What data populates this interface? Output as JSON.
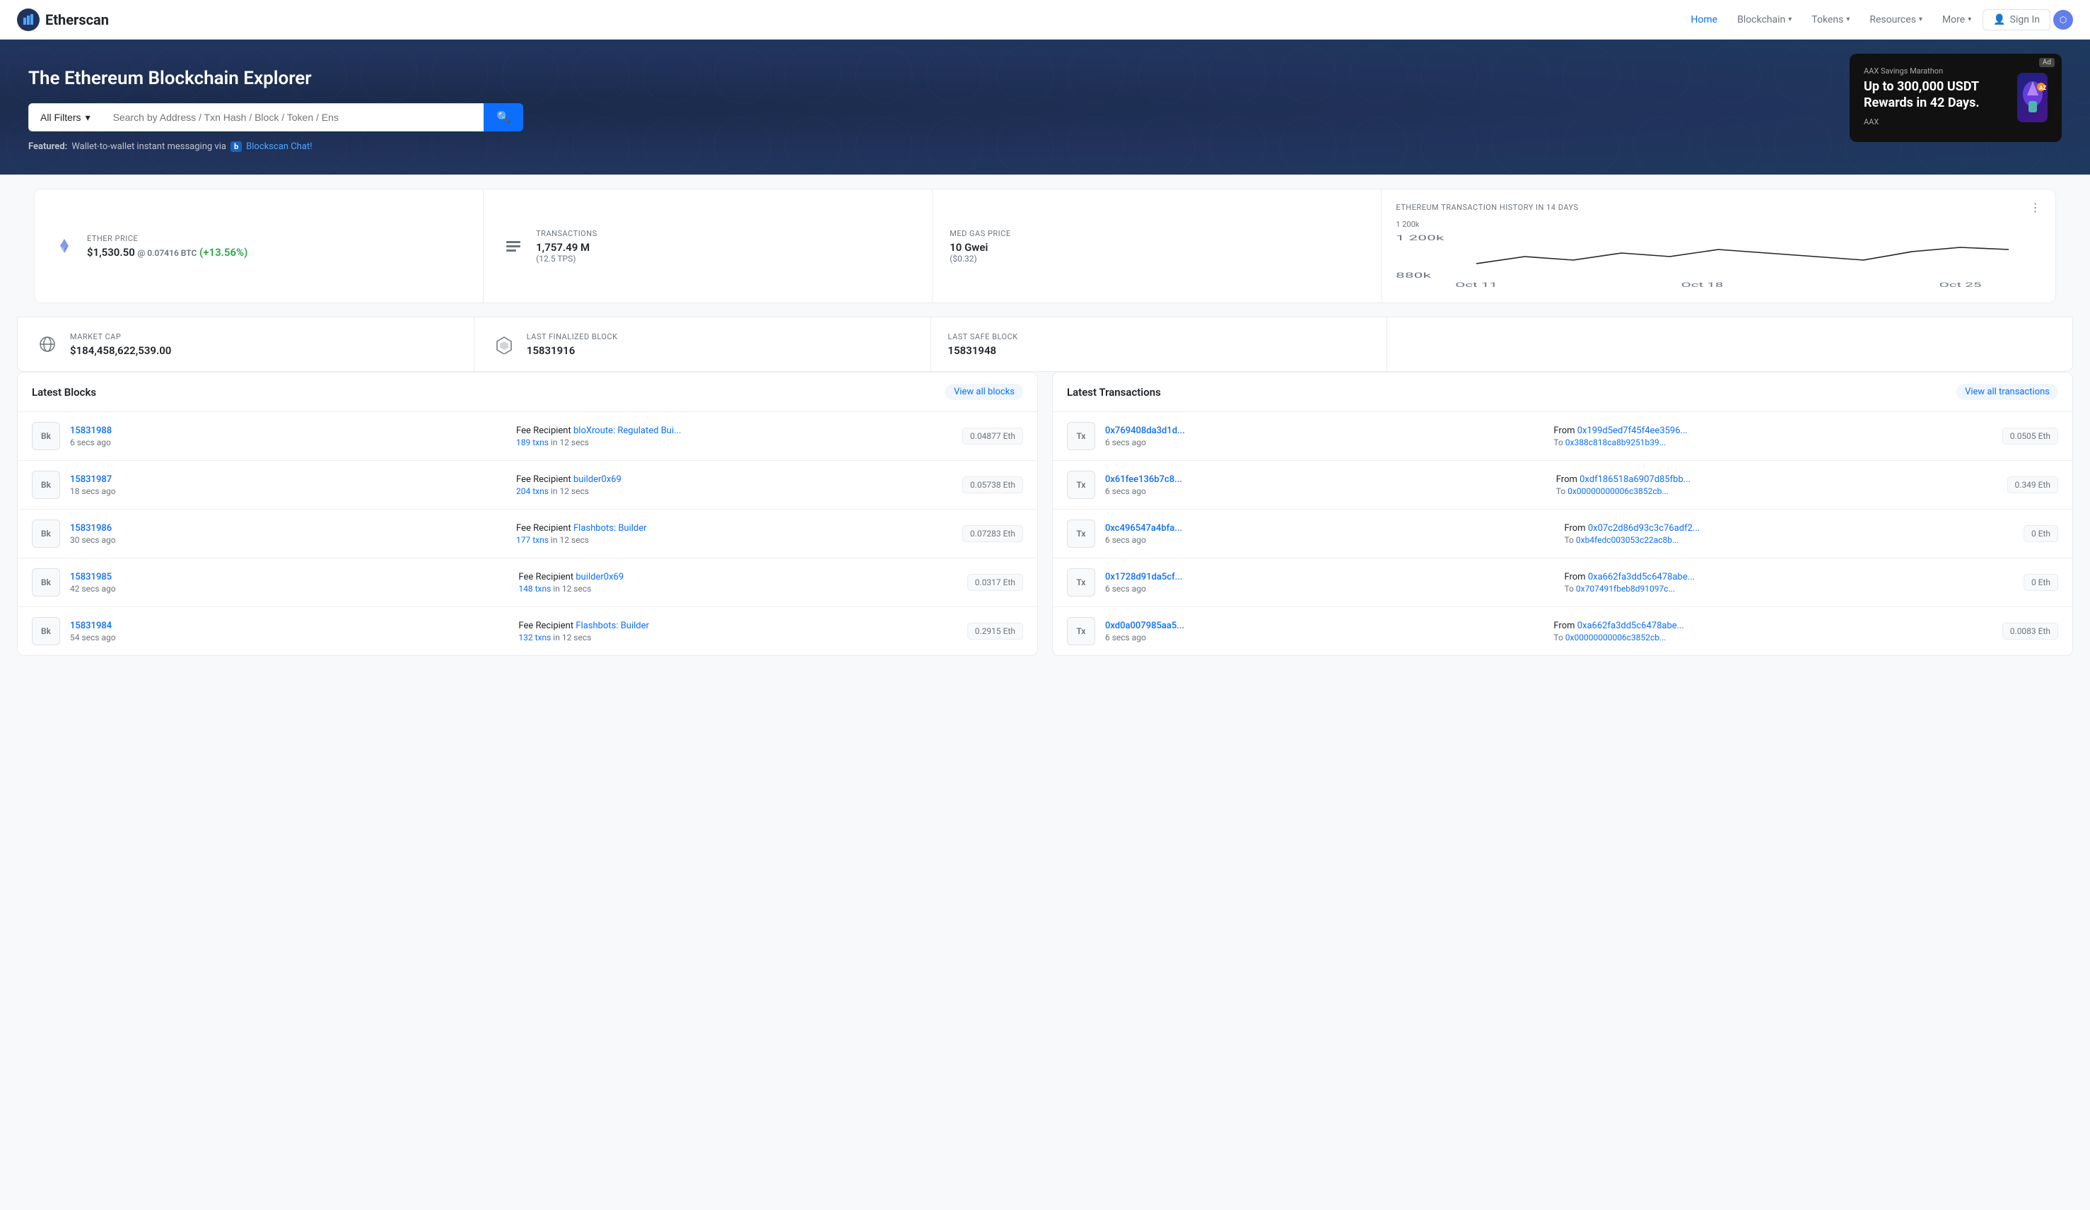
{
  "header": {
    "logo_text": "Etherscan",
    "nav_items": [
      {
        "label": "Home",
        "active": true,
        "has_dropdown": false
      },
      {
        "label": "Blockchain",
        "active": false,
        "has_dropdown": true
      },
      {
        "label": "Tokens",
        "active": false,
        "has_dropdown": true
      },
      {
        "label": "Resources",
        "active": false,
        "has_dropdown": true
      },
      {
        "label": "More",
        "active": false,
        "has_dropdown": true
      }
    ],
    "sign_in": "Sign In"
  },
  "hero": {
    "title": "The Ethereum Blockchain Explorer",
    "search": {
      "filter_label": "All Filters",
      "placeholder": "Search by Address / Txn Hash / Block / Token / Ens",
      "button_icon": "🔍"
    },
    "featured": {
      "label": "Featured:",
      "text": "Wallet-to-wallet instant messaging via",
      "b_label": "b",
      "link_text": "Blockscan Chat!"
    },
    "ad": {
      "ad_label": "Ad",
      "brand": "AAX Savings Marathon",
      "headline": "Up to 300,000 USDT Rewards in 42 Days.",
      "sub": "AAX"
    }
  },
  "stats": {
    "ether_price": {
      "label": "ETHER PRICE",
      "value": "$1,530.50",
      "btc": "@ 0.07416 BTC",
      "change": "(+13.56%)"
    },
    "transactions": {
      "label": "TRANSACTIONS",
      "value": "1,757.49 M",
      "sub": "(12.5 TPS)"
    },
    "med_gas": {
      "label": "MED GAS PRICE",
      "value": "10 Gwei",
      "sub": "($0.32)"
    },
    "market_cap": {
      "label": "MARKET CAP",
      "value": "$184,458,622,539.00"
    },
    "last_finalized": {
      "label": "LAST FINALIZED BLOCK",
      "value": "15831916"
    },
    "last_safe": {
      "label": "LAST SAFE BLOCK",
      "value": "15831948"
    },
    "chart": {
      "title": "ETHEREUM TRANSACTION HISTORY IN 14 DAYS",
      "y_high": "1 200k",
      "y_low": "880k",
      "x_labels": [
        "Oct 11",
        "Oct 18",
        "Oct 25"
      ]
    }
  },
  "latest_blocks": {
    "title": "Latest Blocks",
    "view_all": "View all blocks",
    "items": [
      {
        "badge": "Bk",
        "block_num": "15831988",
        "time": "6 secs ago",
        "fee_label": "Fee Recipient",
        "fee_recipient": "bloXroute: Regulated Bui...",
        "txns_text": "189 txns",
        "txns_time": " in 12 secs",
        "amount": "0.04877 Eth"
      },
      {
        "badge": "Bk",
        "block_num": "15831987",
        "time": "18 secs ago",
        "fee_label": "Fee Recipient",
        "fee_recipient": "builder0x69",
        "txns_text": "204 txns",
        "txns_time": " in 12 secs",
        "amount": "0.05738 Eth"
      },
      {
        "badge": "Bk",
        "block_num": "15831986",
        "time": "30 secs ago",
        "fee_label": "Fee Recipient",
        "fee_recipient": "Flashbots: Builder",
        "txns_text": "177 txns",
        "txns_time": " in 12 secs",
        "amount": "0.07283 Eth"
      },
      {
        "badge": "Bk",
        "block_num": "15831985",
        "time": "42 secs ago",
        "fee_label": "Fee Recipient",
        "fee_recipient": "builder0x69",
        "txns_text": "148 txns",
        "txns_time": " in 12 secs",
        "amount": "0.0317 Eth"
      },
      {
        "badge": "Bk",
        "block_num": "15831984",
        "time": "54 secs ago",
        "fee_label": "Fee Recipient",
        "fee_recipient": "Flashbots: Builder",
        "txns_text": "132 txns",
        "txns_time": " in 12 secs",
        "amount": "0.2915 Eth"
      }
    ]
  },
  "latest_transactions": {
    "title": "Latest Transactions",
    "view_all": "View all transactions",
    "items": [
      {
        "badge": "Tx",
        "tx_hash": "0x769408da3d1d...",
        "time": "6 secs ago",
        "from": "0x199d5ed7f45f4ee3596...",
        "to": "0x388c818ca8b9251b39...",
        "amount": "0.0505 Eth"
      },
      {
        "badge": "Tx",
        "tx_hash": "0x61fee136b7c8...",
        "time": "6 secs ago",
        "from": "0xdf186518a6907d85fbb...",
        "to": "0x00000000006c3852cb...",
        "amount": "0.349 Eth"
      },
      {
        "badge": "Tx",
        "tx_hash": "0xc496547a4bfa...",
        "time": "6 secs ago",
        "from": "0x07c2d86d93c3c76adf2...",
        "to": "0xb4fedc003053c22ac8b...",
        "amount": "0 Eth"
      },
      {
        "badge": "Tx",
        "tx_hash": "0x1728d91da5cf...",
        "time": "6 secs ago",
        "from": "0xa662fa3dd5c6478abe...",
        "to": "0x707491fbeb8d91097c...",
        "amount": "0 Eth"
      },
      {
        "badge": "Tx",
        "tx_hash": "0xd0a007985aa5...",
        "time": "6 secs ago",
        "from": "0xa662fa3dd5c6478abe...",
        "to": "0x00000000006c3852cb...",
        "amount": "0.0083 Eth"
      }
    ]
  }
}
